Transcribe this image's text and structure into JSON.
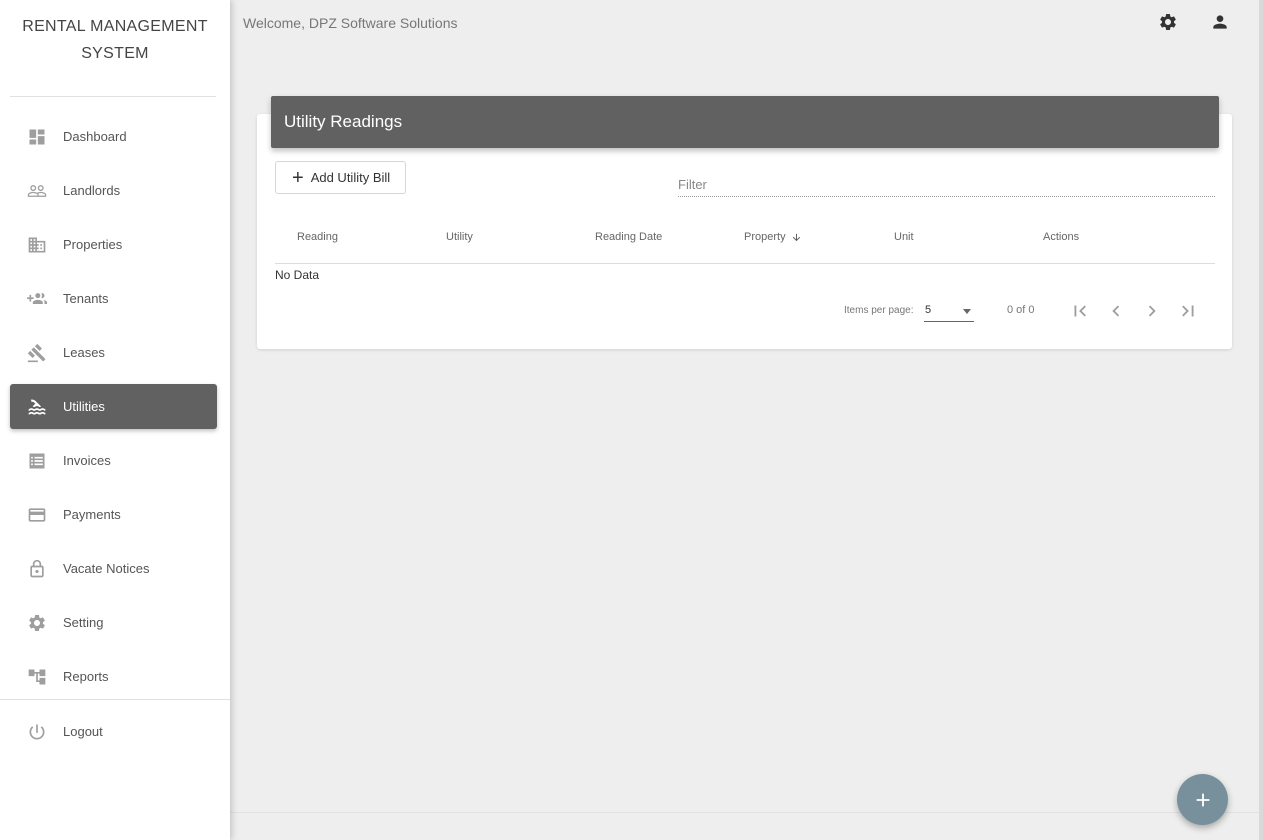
{
  "app": {
    "title_line1": "RENTAL MANAGEMENT",
    "title_line2": "SYSTEM"
  },
  "header": {
    "welcome": "Welcome, DPZ Software Solutions",
    "settings_icon": "gear-icon",
    "account_icon": "person-icon"
  },
  "sidebar": {
    "items": [
      {
        "label": "Dashboard",
        "icon": "dashboard-icon"
      },
      {
        "label": "Landlords",
        "icon": "people-outline-icon"
      },
      {
        "label": "Properties",
        "icon": "building-icon"
      },
      {
        "label": "Tenants",
        "icon": "group-add-icon"
      },
      {
        "label": "Leases",
        "icon": "gavel-icon"
      },
      {
        "label": "Utilities",
        "icon": "pool-water-icon",
        "active": true
      },
      {
        "label": "Invoices",
        "icon": "receipt-list-icon"
      },
      {
        "label": "Payments",
        "icon": "credit-card-icon"
      },
      {
        "label": "Vacate Notices",
        "icon": "lock-open-icon"
      },
      {
        "label": "Setting",
        "icon": "gear-icon"
      },
      {
        "label": "Reports",
        "icon": "account-tree-icon"
      }
    ],
    "logout": {
      "label": "Logout",
      "icon": "power-icon"
    }
  },
  "card": {
    "title": "Utility Readings",
    "add_button": "Add Utility Bill",
    "filter_placeholder": "Filter",
    "columns": [
      "Reading",
      "Utility",
      "Reading Date",
      "Property",
      "Unit",
      "Actions"
    ],
    "sorted_column": "Property",
    "sort_direction": "descending",
    "empty_text": "No Data",
    "paginator": {
      "items_per_page_label": "Items per page:",
      "items_per_page": "5",
      "range": "0 of 0"
    }
  },
  "colors": {
    "active_nav": "#616161",
    "card_header": "#616161",
    "fab": "#78909c",
    "background": "#eeeeee"
  }
}
